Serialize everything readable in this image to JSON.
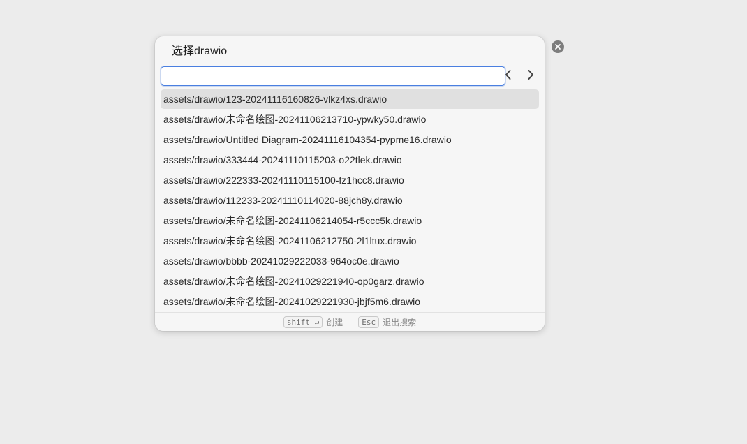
{
  "dialog": {
    "title": "选择drawio",
    "search": {
      "value": "",
      "placeholder": ""
    },
    "nav": {
      "prev_icon": "chevron-left-icon",
      "next_icon": "chevron-right-icon"
    },
    "results": [
      "assets/drawio/123-20241116160826-vlkz4xs.drawio",
      "assets/drawio/未命名绘图-20241106213710-ypwky50.drawio",
      "assets/drawio/Untitled Diagram-20241116104354-pypme16.drawio",
      "assets/drawio/333444-20241110115203-o22tlek.drawio",
      "assets/drawio/222333-20241110115100-fz1hcc8.drawio",
      "assets/drawio/112233-20241110114020-88jch8y.drawio",
      "assets/drawio/未命名绘图-20241106214054-r5ccc5k.drawio",
      "assets/drawio/未命名绘图-20241106212750-2l1ltux.drawio",
      "assets/drawio/bbbb-20241029222033-964oc0e.drawio",
      "assets/drawio/未命名绘图-20241029221940-op0garz.drawio",
      "assets/drawio/未命名绘图-20241029221930-jbjf5m6.drawio"
    ],
    "selected_index": 0,
    "footer": {
      "create_key": "shift ↵",
      "create_label": "创建",
      "exit_key": "Esc",
      "exit_label": "退出搜索"
    }
  },
  "close_icon": "close-icon",
  "colors": {
    "background": "#ececec",
    "dialog": "#f6f6f6",
    "input_focus": "#4a7fe0",
    "selected_row": "#e0e0e0"
  }
}
